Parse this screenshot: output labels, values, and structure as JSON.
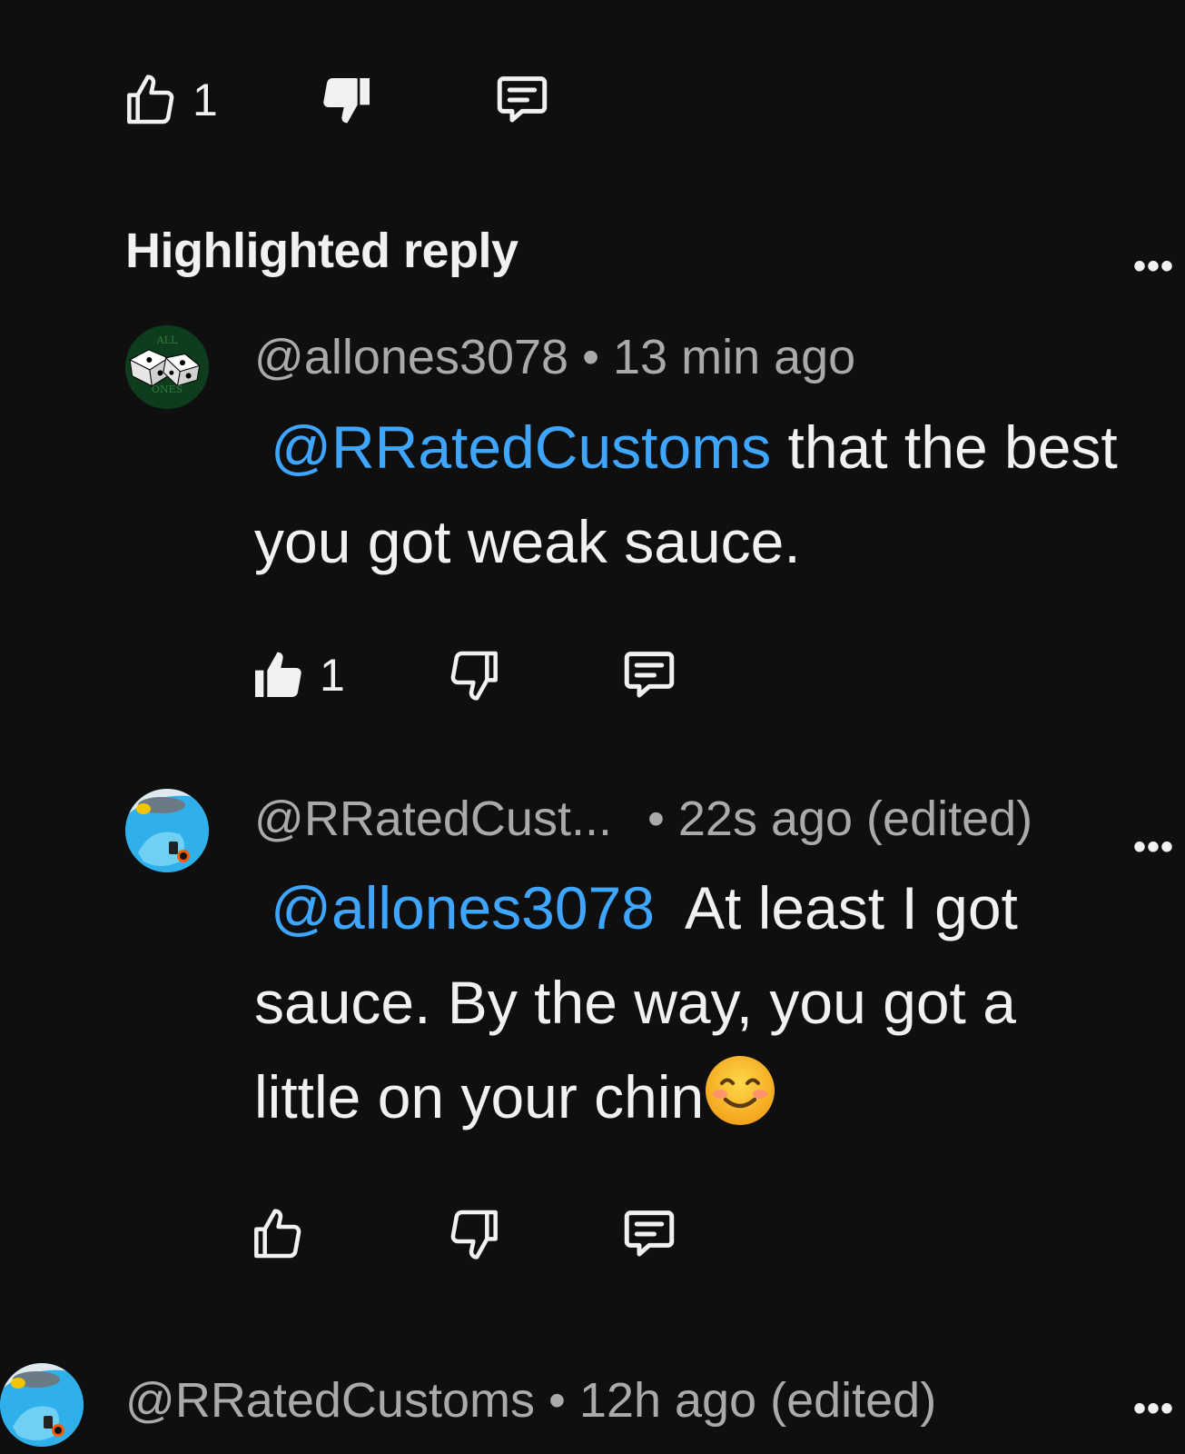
{
  "top_comment_actions": {
    "like_count": "1"
  },
  "highlighted": {
    "section_title": "Highlighted reply",
    "more_label": "•••"
  },
  "reply1": {
    "handle": "@allones3078",
    "separator": "•",
    "time": "13 min ago",
    "mention": "@RRatedCustoms",
    "text_after_mention": " that the best you got weak sauce.",
    "like_count": "1",
    "avatar_text_top": "ALL",
    "avatar_text_bottom": "ONES"
  },
  "reply2": {
    "handle": "@RRatedCust...",
    "separator": "•",
    "time": "22s ago (edited)",
    "mention": "@allones3078",
    "text_after_mention": "  At least I got sauce. By the way, you got a little on your chin",
    "emoji": "smiling-face-emoji",
    "more_label": "•••"
  },
  "next_comment": {
    "handle": "@RRatedCustoms",
    "separator": "•",
    "time": "12h ago (edited)",
    "more_label": "•••"
  },
  "colors": {
    "background": "#0f0f0f",
    "text": "#f1f1f1",
    "meta": "#aaaaaa",
    "mention": "#3ea6ff"
  }
}
